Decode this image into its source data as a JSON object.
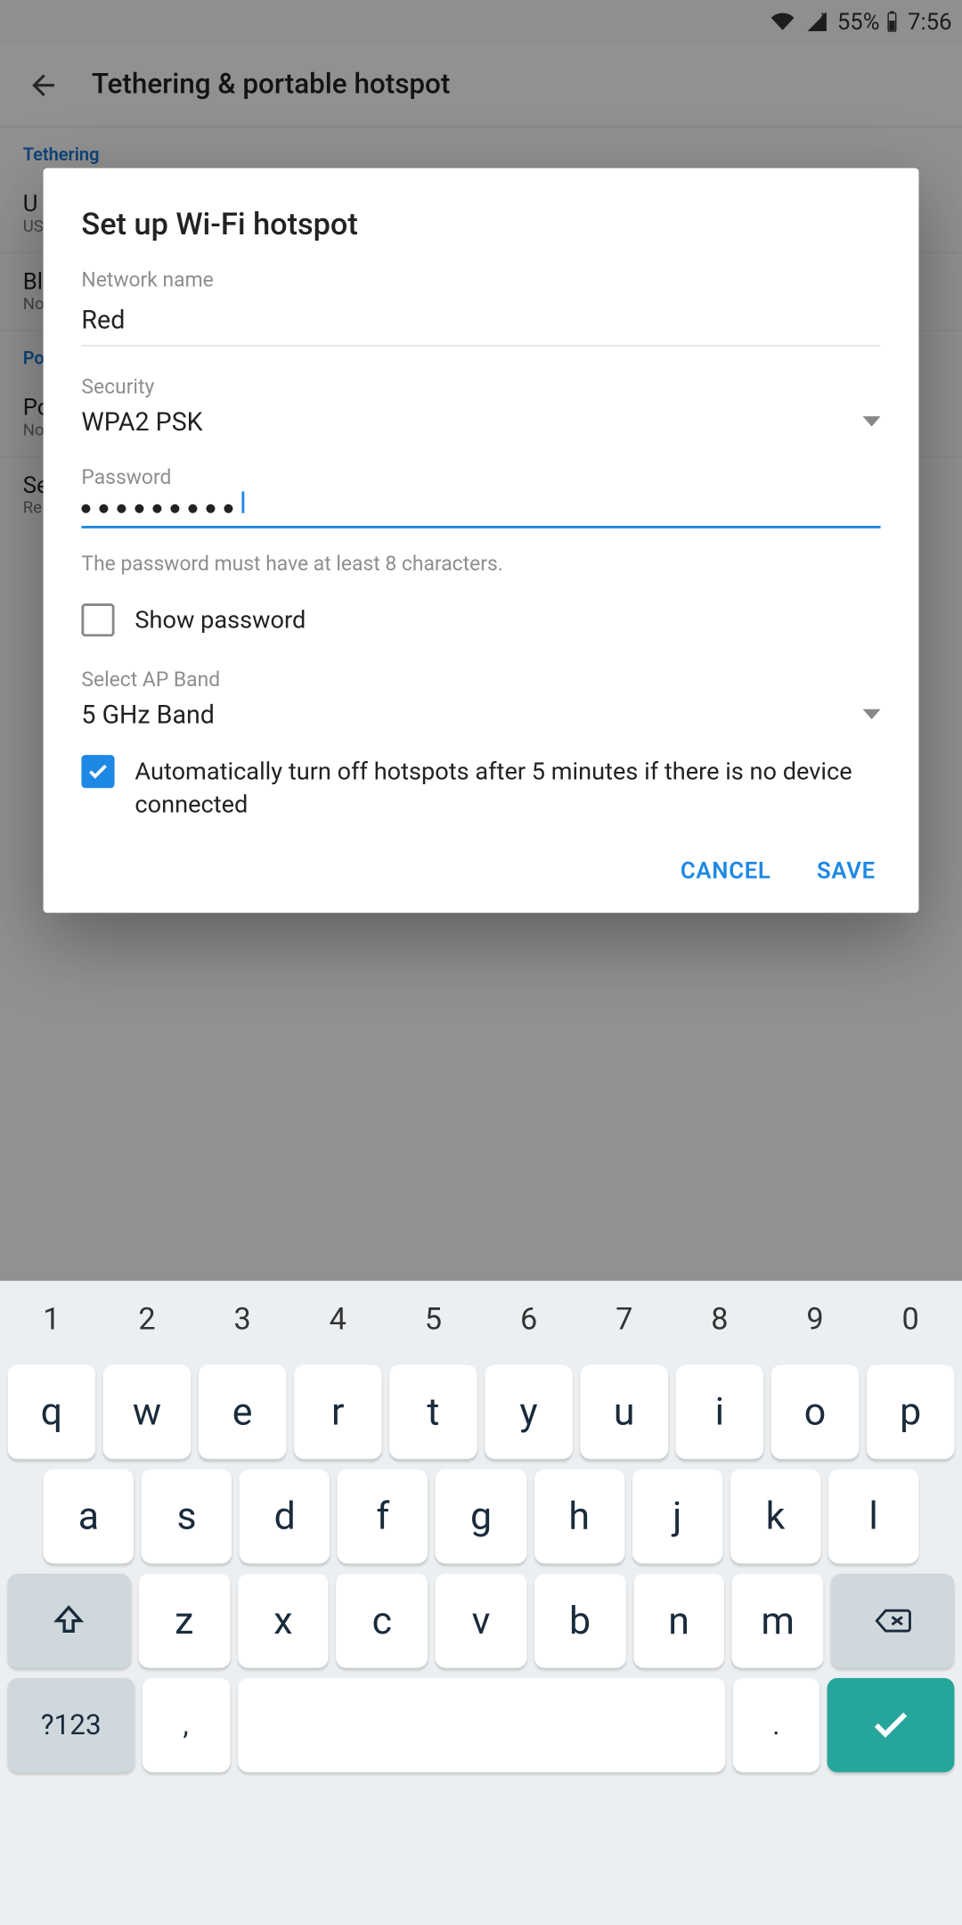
{
  "status": {
    "battery_pct": "55%",
    "time": "7:56"
  },
  "appbar": {
    "title": "Tethering & portable hotspot"
  },
  "bg": {
    "section1": "Tethering",
    "row1": {
      "title": "U",
      "sub": "US"
    },
    "row2": {
      "title": "Bl",
      "sub": "No"
    },
    "section2": "Po",
    "row3": {
      "title": "Po",
      "sub": "No"
    },
    "row4": {
      "title": "Se",
      "sub": "Re"
    }
  },
  "dialog": {
    "title": "Set up Wi-Fi hotspot",
    "network_name_label": "Network name",
    "network_name_value": "Red",
    "security_label": "Security",
    "security_value": "WPA2 PSK",
    "password_label": "Password",
    "password_masked": "•••••••••",
    "password_hint": "The password must have at least 8 characters.",
    "show_password_label": "Show password",
    "show_password_checked": false,
    "ap_band_label": "Select AP Band",
    "ap_band_value": "5 GHz Band",
    "auto_off_label": "Automatically turn off hotspots after 5 minutes if there is no device connected",
    "auto_off_checked": true,
    "cancel_label": "CANCEL",
    "save_label": "SAVE"
  },
  "keyboard": {
    "row_num": [
      "1",
      "2",
      "3",
      "4",
      "5",
      "6",
      "7",
      "8",
      "9",
      "0"
    ],
    "row_q": [
      "q",
      "w",
      "e",
      "r",
      "t",
      "y",
      "u",
      "i",
      "o",
      "p"
    ],
    "row_a": [
      "a",
      "s",
      "d",
      "f",
      "g",
      "h",
      "j",
      "k",
      "l"
    ],
    "row_z": [
      "z",
      "x",
      "c",
      "v",
      "b",
      "n",
      "m"
    ],
    "sym_label": "?123",
    "comma": ",",
    "period": "."
  }
}
